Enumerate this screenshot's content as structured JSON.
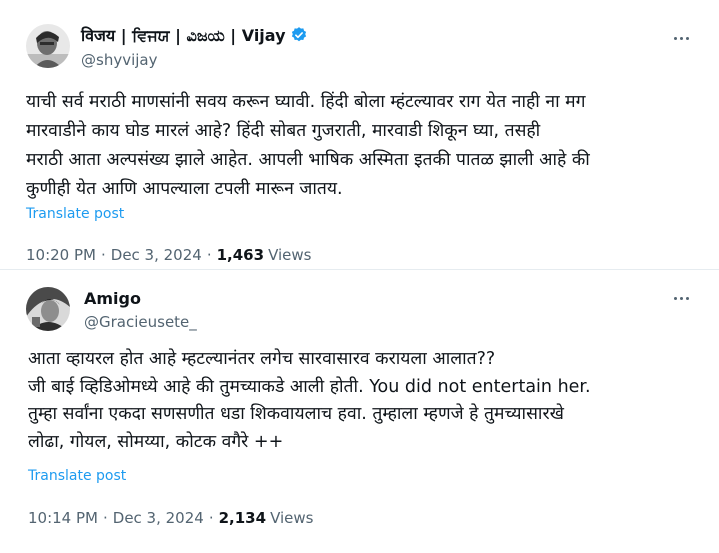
{
  "posts": [
    {
      "display_name": "विजय | ਵਿਜਯ | ವಿಜಯ | Vijay",
      "handle": "@shyvijay",
      "verified": true,
      "text": "याची सर्व मराठी माणसांनी सवय करून घ्यावी. हिंदी बोला म्हंटल्यावर राग येत नाही ना मग\nमारवाडीने काय घोड मारलं आहे? हिंदी सोबत गुजराती, मारवाडी शिकून घ्या, तसही\nमराठी आता अल्पसंख्य झाले आहेत. आपली भाषिक अस्मिता इतकी पातळ झाली आहे की\nकुणीही येत आणि आपल्याला टपली मारून जातय.",
      "translate_label": "Translate post",
      "time": "10:20 PM",
      "date": "Dec 3, 2024",
      "views_count": "1,463",
      "views_label": "Views"
    },
    {
      "display_name": "Amigo",
      "handle": "@Gracieusete_",
      "verified": false,
      "text": "आता व्हायरल होत आहे म्हटल्यानंतर लगेच सारवासारव करायला आलात??\nजी बाई व्हिडिओमध्ये आहे की तुमच्याकडे आली होती. You did not entertain her.\nतुम्हा सर्वांना एकदा सणसणीत धडा शिकवायलाच हवा. तुम्हाला म्हणजे हे तुमच्यासारखे\nलोढा, गोयल, सोमय्या, कोटक वगैरे   ++",
      "translate_label": "Translate post",
      "time": "10:14 PM",
      "date": "Dec 3, 2024",
      "views_count": "2,134",
      "views_label": "Views"
    }
  ],
  "icons": {
    "verified": "verified-badge-icon",
    "more": "more-options-icon"
  },
  "colors": {
    "accent": "#1d9bf0",
    "secondary_text": "#536471",
    "primary_text": "#0f1419",
    "divider": "#e6ecf0"
  },
  "separator": "·"
}
